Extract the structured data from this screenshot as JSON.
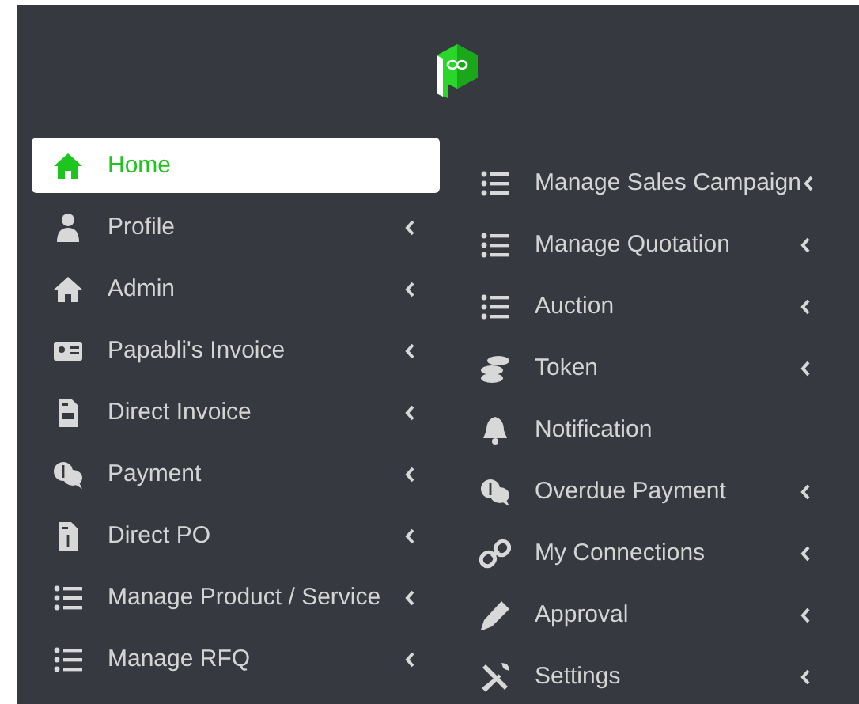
{
  "columns": [
    {
      "items": [
        {
          "label": "Home",
          "selected": true,
          "expandable": false
        },
        {
          "label": "Profile",
          "selected": false,
          "expandable": true
        },
        {
          "label": "Admin",
          "selected": false,
          "expandable": true
        },
        {
          "label": "Papabli's Invoice",
          "selected": false,
          "expandable": true
        },
        {
          "label": "Direct Invoice",
          "selected": false,
          "expandable": true
        },
        {
          "label": "Payment",
          "selected": false,
          "expandable": true
        },
        {
          "label": "Direct PO",
          "selected": false,
          "expandable": true
        },
        {
          "label": "Manage Product / Service",
          "selected": false,
          "expandable": true
        },
        {
          "label": "Manage RFQ",
          "selected": false,
          "expandable": true
        }
      ]
    },
    {
      "items": [
        {
          "label": "Manage Sales Campaign",
          "selected": false,
          "expandable": true
        },
        {
          "label": "Manage Quotation",
          "selected": false,
          "expandable": true
        },
        {
          "label": "Auction",
          "selected": false,
          "expandable": true
        },
        {
          "label": "Token",
          "selected": false,
          "expandable": true
        },
        {
          "label": "Notification",
          "selected": false,
          "expandable": false
        },
        {
          "label": "Overdue Payment",
          "selected": false,
          "expandable": true
        },
        {
          "label": "My Connections",
          "selected": false,
          "expandable": true
        },
        {
          "label": "Approval",
          "selected": false,
          "expandable": true
        },
        {
          "label": "Settings",
          "selected": false,
          "expandable": true
        }
      ]
    }
  ]
}
